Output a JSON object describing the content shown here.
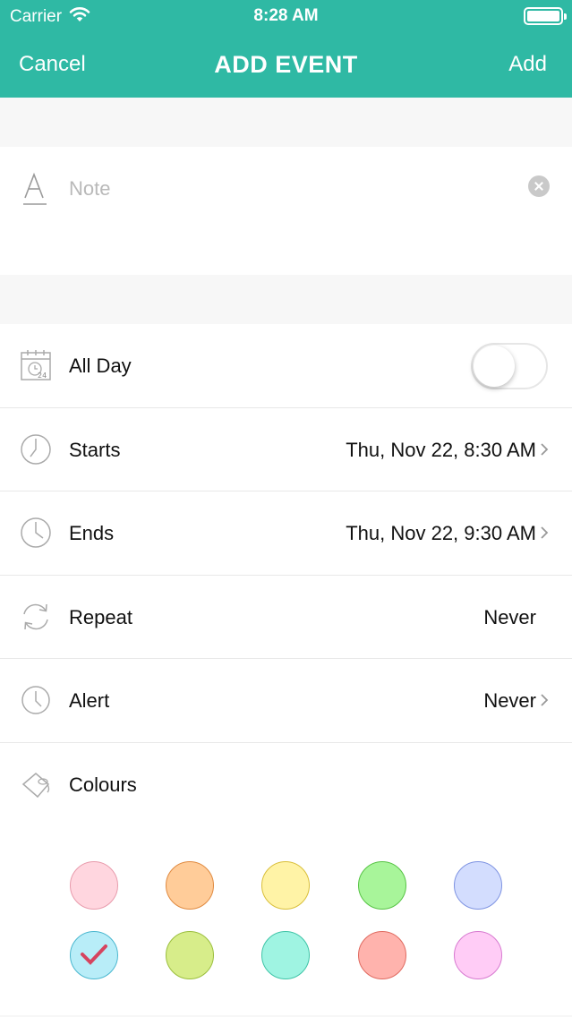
{
  "status_bar": {
    "carrier": "Carrier",
    "time": "8:28 AM"
  },
  "nav": {
    "cancel_label": "Cancel",
    "title": "ADD EVENT",
    "add_label": "Add"
  },
  "note": {
    "placeholder": "Note",
    "icon": "text-icon"
  },
  "rows": {
    "all_day": {
      "label": "All Day",
      "icon": "calendar-24-icon",
      "toggle_on": false
    },
    "starts": {
      "label": "Starts",
      "value": "Thu, Nov 22, 8:30 AM",
      "icon": "clock-icon"
    },
    "ends": {
      "label": "Ends",
      "value": "Thu, Nov 22, 9:30 AM",
      "icon": "clock-icon"
    },
    "repeat": {
      "label": "Repeat",
      "value": "Never",
      "icon": "repeat-icon"
    },
    "alert": {
      "label": "Alert",
      "value": "Never",
      "icon": "alarm-icon"
    },
    "colours": {
      "label": "Colours",
      "icon": "paint-bucket-icon"
    }
  },
  "colours": {
    "selected_index": 5,
    "swatches": [
      {
        "fill": "#ffd6df",
        "border": "#e89bac"
      },
      {
        "fill": "#ffcc99",
        "border": "#e08a40"
      },
      {
        "fill": "#fff3a6",
        "border": "#d9bf3a"
      },
      {
        "fill": "#a8f59a",
        "border": "#57c445"
      },
      {
        "fill": "#d3ddfe",
        "border": "#7e93e2"
      },
      {
        "fill": "#b8edf8",
        "border": "#4ab7cf"
      },
      {
        "fill": "#d7ed8a",
        "border": "#9bbf3d"
      },
      {
        "fill": "#9ff4e2",
        "border": "#3fc4a7"
      },
      {
        "fill": "#ffb3ad",
        "border": "#e06a60"
      },
      {
        "fill": "#ffccf6",
        "border": "#d77ad0"
      }
    ],
    "check_color": "#d6445f"
  },
  "theme": {
    "header": "#2fb9a4",
    "section_bg": "#f7f7f7"
  }
}
